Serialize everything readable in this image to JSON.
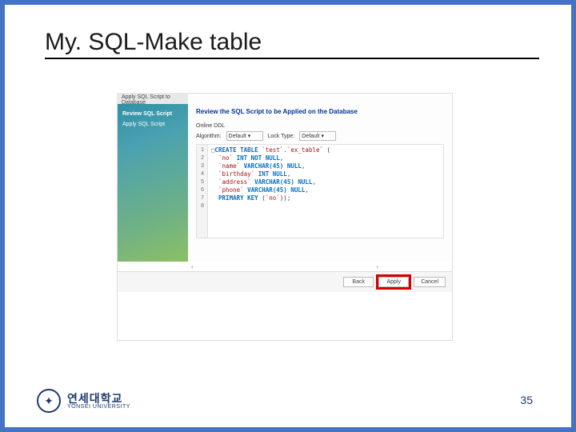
{
  "slide": {
    "title": "My. SQL-Make table",
    "page_number": "35"
  },
  "logo": {
    "ko": "연세대학교",
    "en": "YONSEI UNIVERSITY"
  },
  "workbench": {
    "window_title": "Apply SQL Script to Database",
    "sidebar": {
      "items": [
        "Review SQL Script",
        "Apply SQL Script"
      ]
    },
    "main": {
      "title": "Review the SQL Script to be Applied on the Database",
      "online_ddl_label": "Online DDL",
      "algorithm_label": "Algorithm:",
      "algorithm_value": "Default",
      "lock_label": "Lock Type:",
      "lock_value": "Default"
    },
    "code": {
      "line_numbers": [
        "1",
        "2",
        "3",
        "4",
        "5",
        "6",
        "7",
        "8"
      ],
      "l1_kw": "CREATE TABLE",
      "l1_schema": "`test`",
      "l1_dot": ".",
      "l1_tbl": "`ex_table`",
      "l1_open": " (",
      "l2_col": "  `no`",
      "l2_type": " INT",
      "l2_nn": " NOT NULL",
      "l2_end": ",",
      "l3_col": "  `name`",
      "l3_type": " VARCHAR(45)",
      "l3_nn": " NULL",
      "l3_end": ",",
      "l4_col": "  `birthday`",
      "l4_type": " INT",
      "l4_nn": " NULL",
      "l4_end": ",",
      "l5_col": "  `address`",
      "l5_type": " VARCHAR(45)",
      "l5_nn": " NULL",
      "l5_end": ",",
      "l6_col": "  `phone`",
      "l6_type": " VARCHAR(45)",
      "l6_nn": " NULL",
      "l6_end": ",",
      "l7_kw": "  PRIMARY KEY",
      "l7_open": " (",
      "l7_col": "`no`",
      "l7_close": "));",
      "l8": ""
    },
    "buttons": {
      "back": "Back",
      "apply": "Apply",
      "cancel": "Cancel"
    },
    "scroll": {
      "left": "‹",
      "right": "›"
    }
  }
}
